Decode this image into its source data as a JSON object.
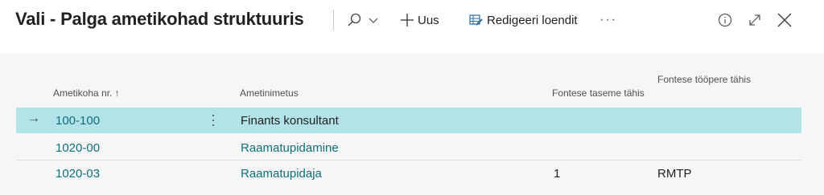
{
  "header": {
    "title": "Vali - Palga ametikohad struktuuris",
    "new_label": "Uus",
    "edit_list_label": "Redigeeri loendit",
    "more_label": "···"
  },
  "grid": {
    "columns": [
      {
        "label": "Ametikoha nr. ↑"
      },
      {
        "label": "Ametinimetus"
      },
      {
        "label": "Fontese taseme tähis"
      },
      {
        "label": "Fontese tööpere tähis"
      }
    ],
    "rows": [
      {
        "selected": true,
        "code": "100-100",
        "name": "Finants konsultant",
        "level": "",
        "family": ""
      },
      {
        "selected": false,
        "code": "1020-00",
        "name": "Raamatupidamine",
        "level": "",
        "family": ""
      },
      {
        "selected": false,
        "code": "1020-03",
        "name": "Raamatupidaja",
        "level": "1",
        "family": "RMTP"
      }
    ]
  },
  "colors": {
    "selected_row": "#b2e3e8",
    "link": "#0e6e7a",
    "grid_background": "#f6f6f6"
  },
  "icons": {
    "search": "search-icon",
    "chevron": "chevron-down-icon",
    "new": "plus-icon",
    "edit": "edit-list-icon",
    "info": "info-icon",
    "expand": "expand-icon",
    "close": "close-icon",
    "row_arrow": "arrow-right-icon",
    "row_menu": "kebab-menu-icon"
  }
}
